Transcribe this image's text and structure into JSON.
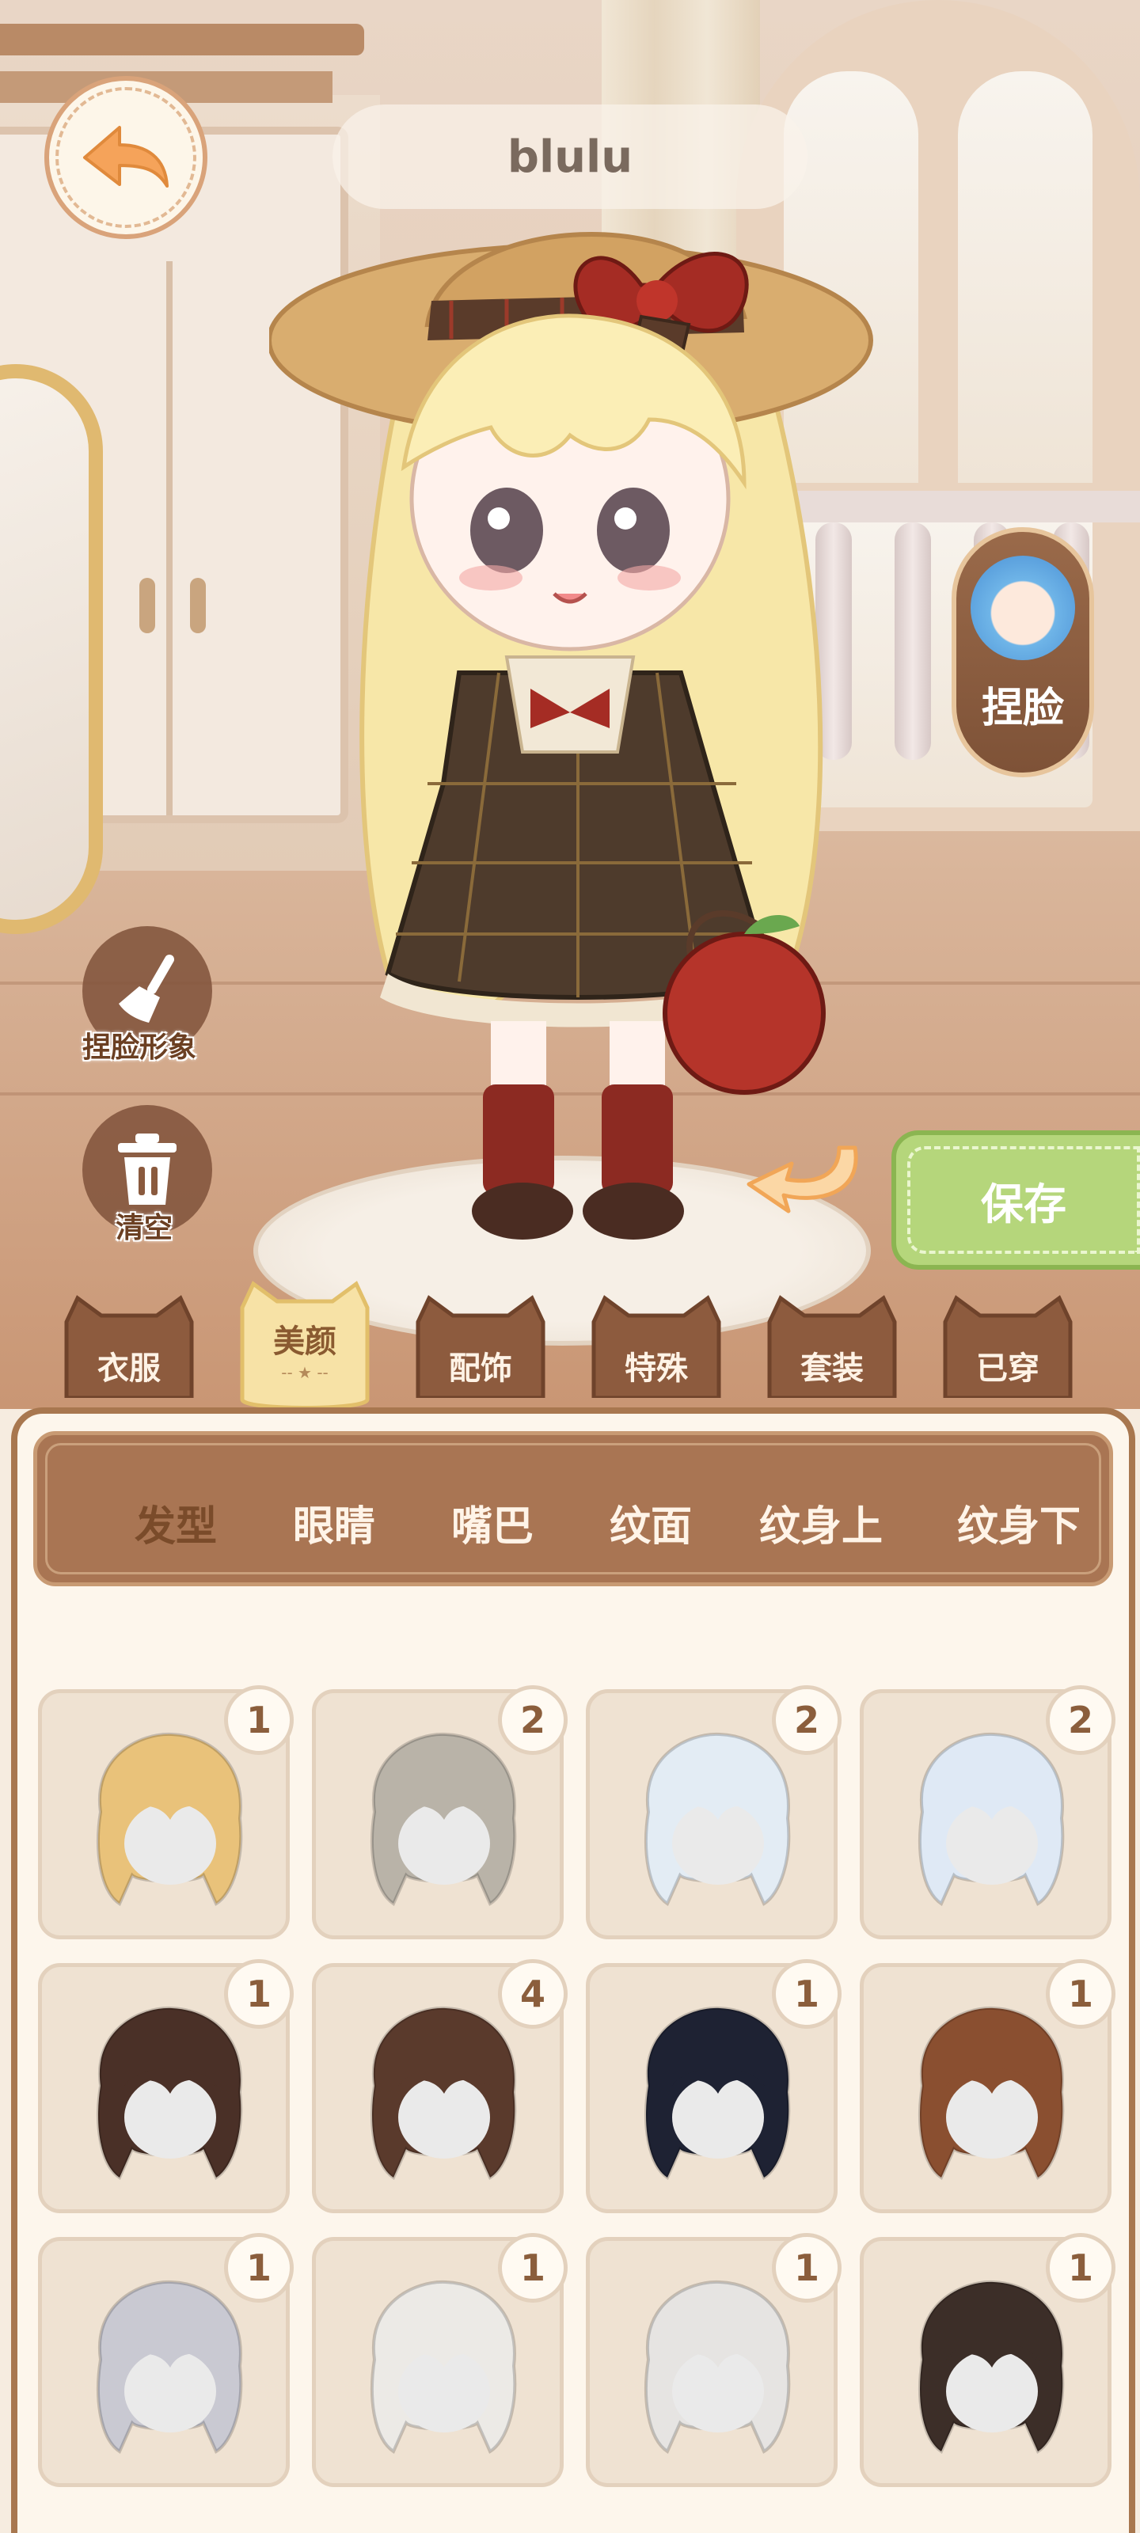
{
  "player": {
    "name": "blulu"
  },
  "buttons": {
    "face_edit": "捏脸",
    "face_look": "捏脸形象",
    "clear": "清空",
    "save": "保存"
  },
  "categories": [
    {
      "label": "衣服",
      "active": false
    },
    {
      "label": "美颜",
      "active": true,
      "sub": "-- ★ --"
    },
    {
      "label": "配饰",
      "active": false
    },
    {
      "label": "特殊",
      "active": false
    },
    {
      "label": "套装",
      "active": false
    },
    {
      "label": "已穿",
      "active": false
    }
  ],
  "subtabs": [
    {
      "label": "发型",
      "active": true
    },
    {
      "label": "眼睛",
      "active": false
    },
    {
      "label": "嘴巴",
      "active": false
    },
    {
      "label": "纹面",
      "active": false
    },
    {
      "label": "纹身上",
      "active": false
    },
    {
      "label": "纹身下",
      "active": false
    }
  ],
  "hair_items": [
    {
      "count": "1",
      "color": "#e9c27a"
    },
    {
      "count": "2",
      "color": "#b9b3a8"
    },
    {
      "count": "2",
      "color": "#e3ecf4"
    },
    {
      "count": "2",
      "color": "#dfe9f5"
    },
    {
      "count": "1",
      "color": "#4a3027"
    },
    {
      "count": "4",
      "color": "#5a3a2c"
    },
    {
      "count": "1",
      "color": "#1e2233"
    },
    {
      "count": "1",
      "color": "#8a4f30"
    },
    {
      "count": "1",
      "color": "#c9c9d2"
    },
    {
      "count": "1",
      "color": "#eceae6"
    },
    {
      "count": "1",
      "color": "#e6e4e2"
    },
    {
      "count": "1",
      "color": "#3c2e28"
    }
  ]
}
